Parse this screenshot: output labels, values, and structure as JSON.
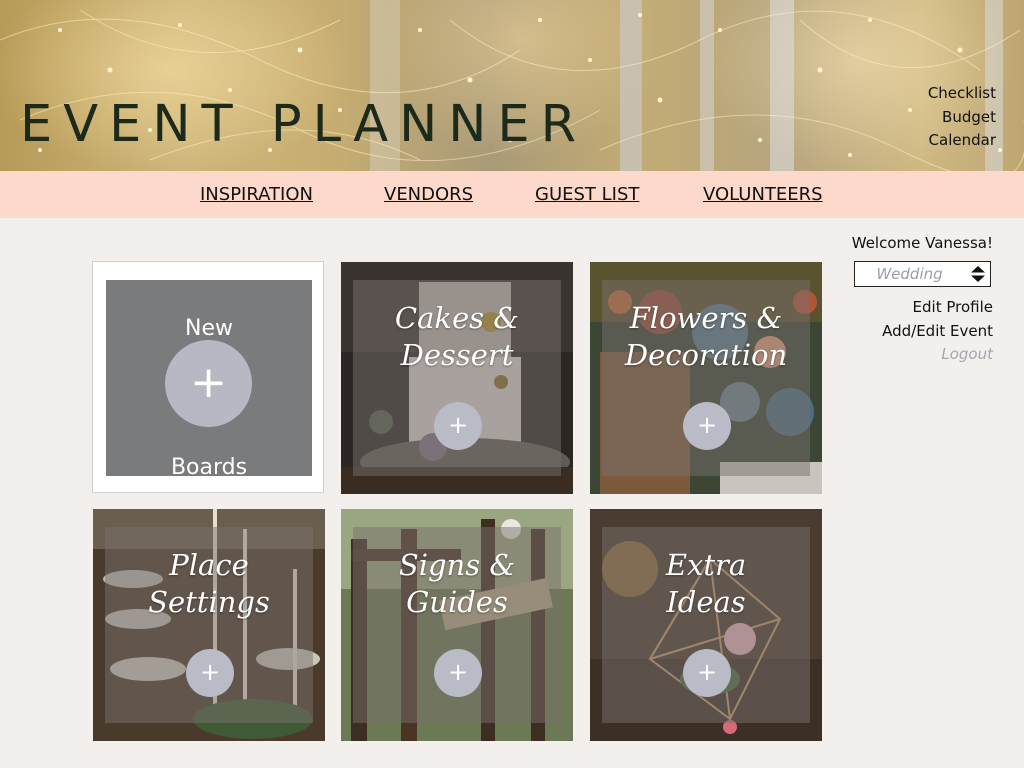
{
  "header": {
    "title": "EVENT PLANNER",
    "links": [
      "Checklist",
      "Budget",
      "Calendar"
    ]
  },
  "nav": {
    "items": [
      "INSPIRATION",
      "VENDORS",
      "GUEST LIST",
      "VOLUNTEERS"
    ]
  },
  "sidebar": {
    "welcome": "Welcome Vanessa!",
    "event_select": {
      "value": "Wedding"
    },
    "links": {
      "edit_profile": "Edit Profile",
      "add_edit_event": "Add/Edit Event",
      "logout": "Logout"
    }
  },
  "boards": {
    "new": {
      "top_label": "New",
      "plus": "+",
      "bottom_label": "Boards"
    },
    "plus_symbol": "+",
    "items": [
      {
        "label": "Cakes &\nDessert"
      },
      {
        "label": "Flowers &\nDecoration"
      },
      {
        "label": "Place\nSettings"
      },
      {
        "label": "Signs &\nGuides"
      },
      {
        "label": "Extra\nIdeas"
      }
    ]
  },
  "colors": {
    "nav_bg": "#fdd9cc",
    "page_bg": "#f3efec",
    "plus_circle": "#b9bbc6",
    "logout": "#a3a5af"
  }
}
